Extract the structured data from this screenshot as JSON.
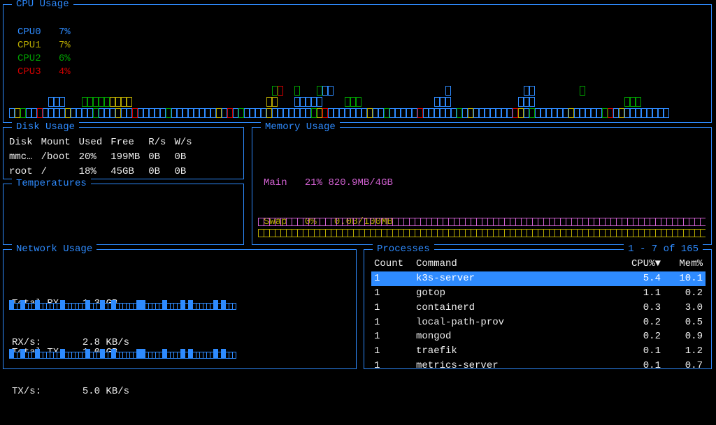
{
  "cpu": {
    "title": "CPU Usage",
    "cores": [
      {
        "name": "CPU0",
        "pct": "7%",
        "cls": "c0"
      },
      {
        "name": "CPU1",
        "pct": "7%",
        "cls": "c1"
      },
      {
        "name": "CPU2",
        "pct": "6%",
        "cls": "c2"
      },
      {
        "name": "CPU3",
        "pct": "4%",
        "cls": "c3"
      }
    ]
  },
  "disk": {
    "title": "Disk Usage",
    "headers": [
      "Disk",
      "Mount",
      "Used",
      "Free",
      "R/s",
      "W/s"
    ],
    "rows": [
      [
        "mmc…",
        "/boot",
        "20%",
        "199MB",
        "0B",
        "0B"
      ],
      [
        "root",
        "/",
        "18%",
        "45GB",
        "0B",
        "0B"
      ]
    ]
  },
  "temps": {
    "title": "Temperatures"
  },
  "mem": {
    "title": "Memory Usage",
    "main": {
      "label": "Main",
      "pct": "21%",
      "detail": "820.9MB/4GB"
    },
    "swap": {
      "label": "Swap",
      "pct": "0%",
      "detail": "0.0B/100MB"
    }
  },
  "net": {
    "title": "Network Usage",
    "rx": {
      "total_label": "Total RX:",
      "total": "1.3 GB",
      "rate_label": "RX/s:",
      "rate": "2.8 KB/s"
    },
    "tx": {
      "total_label": "Total TX:",
      "total": "1.0 GB",
      "rate_label": "TX/s:",
      "rate": "5.0 KB/s"
    }
  },
  "proc": {
    "title": "Processes",
    "range": "1 - 7 of 165",
    "headers": {
      "count": "Count",
      "cmd": "Command",
      "cpu": "CPU%▼",
      "mem": "Mem%"
    },
    "rows": [
      {
        "count": "1",
        "cmd": "k3s-server",
        "cpu": "5.4",
        "mem": "10.1",
        "sel": true
      },
      {
        "count": "1",
        "cmd": "gotop",
        "cpu": "1.1",
        "mem": "0.2"
      },
      {
        "count": "1",
        "cmd": "containerd",
        "cpu": "0.3",
        "mem": "3.0"
      },
      {
        "count": "1",
        "cmd": "local-path-prov",
        "cpu": "0.2",
        "mem": "0.5"
      },
      {
        "count": "1",
        "cmd": "mongod",
        "cpu": "0.2",
        "mem": "0.9"
      },
      {
        "count": "1",
        "cmd": "traefik",
        "cpu": "0.1",
        "mem": "1.2"
      },
      {
        "count": "1",
        "cmd": "metrics-server",
        "cpu": "0.1",
        "mem": "0.7"
      }
    ]
  }
}
